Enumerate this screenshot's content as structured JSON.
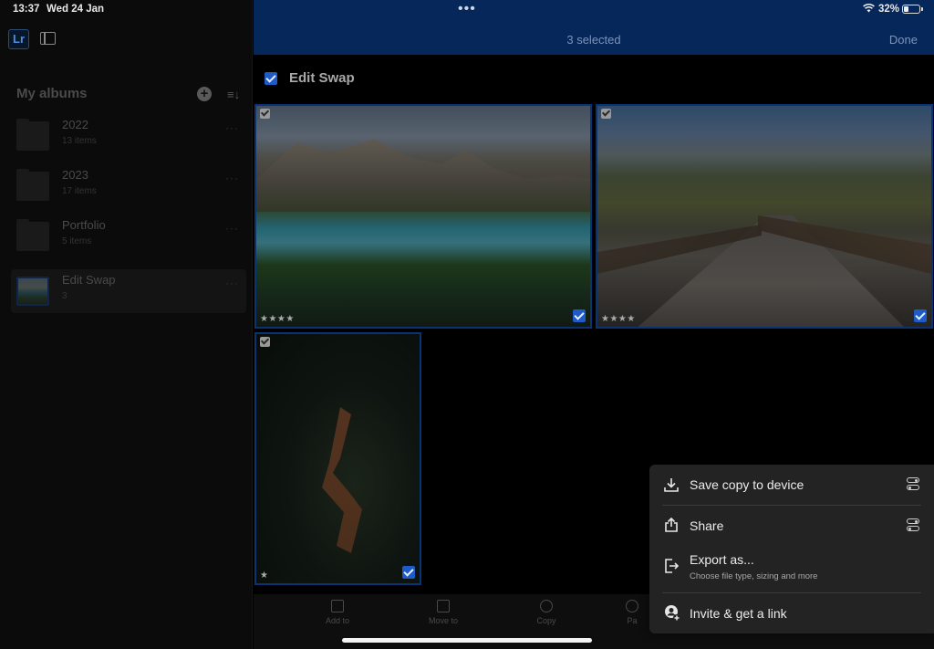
{
  "status_bar": {
    "time": "13:37",
    "date": "Wed 24 Jan",
    "battery_percent": "32%",
    "multitask_dots": "•••"
  },
  "sidebar": {
    "logo": "Lr",
    "heading": "My albums",
    "albums": [
      {
        "name": "2022",
        "count": "13 items"
      },
      {
        "name": "2023",
        "count": "17 items"
      },
      {
        "name": "Portfolio",
        "count": "5 items"
      },
      {
        "name": "Edit Swap",
        "count": "3"
      }
    ]
  },
  "header": {
    "title": "3 selected",
    "done_label": "Done"
  },
  "album": {
    "name": "Edit Swap",
    "photos": [
      {
        "stars": "★★★★",
        "rating": 4
      },
      {
        "stars": "★★★★",
        "rating": 4
      },
      {
        "stars": "★",
        "rating": 1
      }
    ]
  },
  "toolbar": {
    "items": [
      {
        "label": "Add to"
      },
      {
        "label": "Move to"
      },
      {
        "label": "Copy"
      },
      {
        "label": "Pa"
      }
    ]
  },
  "menu": {
    "save_copy": "Save copy to device",
    "share": "Share",
    "export": "Export as...",
    "export_sub": "Choose file type, sizing and more",
    "invite": "Invite & get a link"
  },
  "colors": {
    "selection_blue": "#1e5bc6",
    "header_blue": "#06275a"
  }
}
